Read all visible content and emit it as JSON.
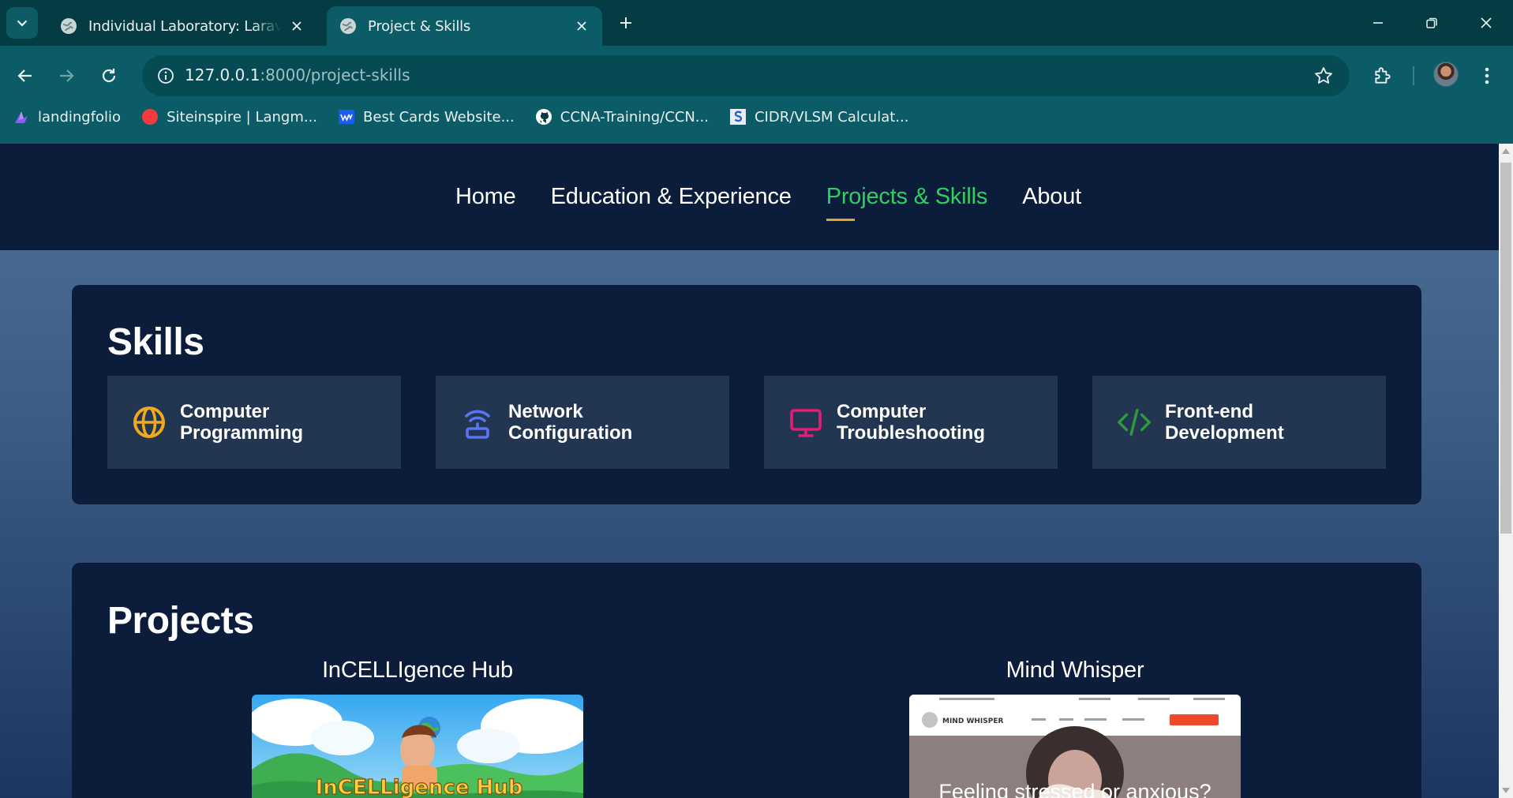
{
  "browser": {
    "tabs": [
      {
        "title": "Individual Laboratory: Laravel In",
        "active": false
      },
      {
        "title": "Project & Skills",
        "active": true
      }
    ],
    "url_host": "127.0.0.1",
    "url_path": ":8000/project-skills",
    "bookmarks": [
      {
        "label": "landingfolio",
        "icon": "landingfolio-icon"
      },
      {
        "label": "Siteinspire | Langm...",
        "icon": "red-dot-icon"
      },
      {
        "label": "Best Cards Website...",
        "icon": "webflow-icon"
      },
      {
        "label": "CCNA-Training/CCN...",
        "icon": "github-icon"
      },
      {
        "label": "CIDR/VLSM Calculat...",
        "icon": "subnet-icon"
      }
    ]
  },
  "site": {
    "nav": [
      {
        "label": "Home",
        "active": false
      },
      {
        "label": "Education & Experience",
        "active": false
      },
      {
        "label": "Projects & Skills",
        "active": true
      },
      {
        "label": "About",
        "active": false
      }
    ],
    "skills_heading": "Skills",
    "skills": [
      {
        "label": "Computer Programming",
        "icon": "globe-icon",
        "color": "#f0a81e"
      },
      {
        "label": "Network Configuration",
        "icon": "router-icon",
        "color": "#5b73f5"
      },
      {
        "label": "Computer Troubleshooting",
        "icon": "monitor-icon",
        "color": "#e11d74"
      },
      {
        "label": "Front-end Development",
        "icon": "code-icon",
        "color": "#2e9a3e"
      }
    ],
    "projects_heading": "Projects",
    "projects": [
      {
        "title": "InCELLIgence Hub",
        "image_text": "InCELLigence Hub"
      },
      {
        "title": "Mind Whisper",
        "image_text": "Feeling stressed or anxious?",
        "image_brand": "MIND WHISPER"
      }
    ]
  },
  "colors": {
    "chrome_tabstrip": "#053c44",
    "chrome_toolbar": "#0b5c66",
    "site_dark": "#0b1d3a",
    "nav_active": "#2fcf60",
    "nav_underline": "#e0a531"
  }
}
